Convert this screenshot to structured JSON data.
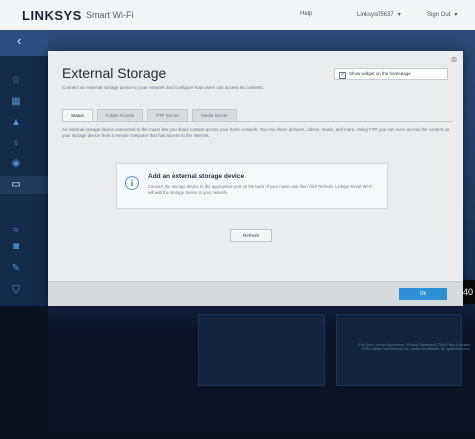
{
  "header": {
    "brand": "LINKSYS",
    "product": "Smart Wi-Fi",
    "links": [
      "Help",
      "Linksys05637",
      "Sign Out"
    ]
  },
  "modal": {
    "title": "External Storage",
    "subtitle": "Connect an external storage device to your network and configure how users can access its contents.",
    "widget_checkbox_label": "Show widget on the homepage",
    "tabs": [
      "Status",
      "Folder Access",
      "FTP Server",
      "Media Server"
    ],
    "description": "An external storage device connected to the router lets you share content across your home network. You can share pictures, videos, music, and more. Using FTP, you can even access the content on your storage device from a remote computer that has access to the Internet.",
    "info": {
      "title": "Add an external storage device",
      "text": "Connect the storage device to the appropriate port on the back of your router and then click Refresh. Linksys Smart Wi-Fi will add the storage device to your network."
    },
    "refresh_label": "Refresh",
    "ok_label": "Ok"
  },
  "sidebar": {
    "icons": [
      "back-icon",
      "star-icon",
      "dashboard-icon",
      "alert-icon",
      "parental-icon",
      "priority-icon",
      "external-storage-icon",
      "wireless-icon",
      "camera-icon",
      "security-icon",
      "shield-icon"
    ]
  },
  "footer": {
    "links": "End User License Agreement | Privacy Statement | Third Party Licenses",
    "copyright": "©2014 Belkin International, Inc. and/or its affiliates. All rights reserved."
  },
  "colors": {
    "accent": "#2d8fd5",
    "sidebar_icon": "#4d8fd0",
    "header_bg": "#f4f5f6",
    "modal_bg": "#e9ebed"
  },
  "partial_text": "40"
}
